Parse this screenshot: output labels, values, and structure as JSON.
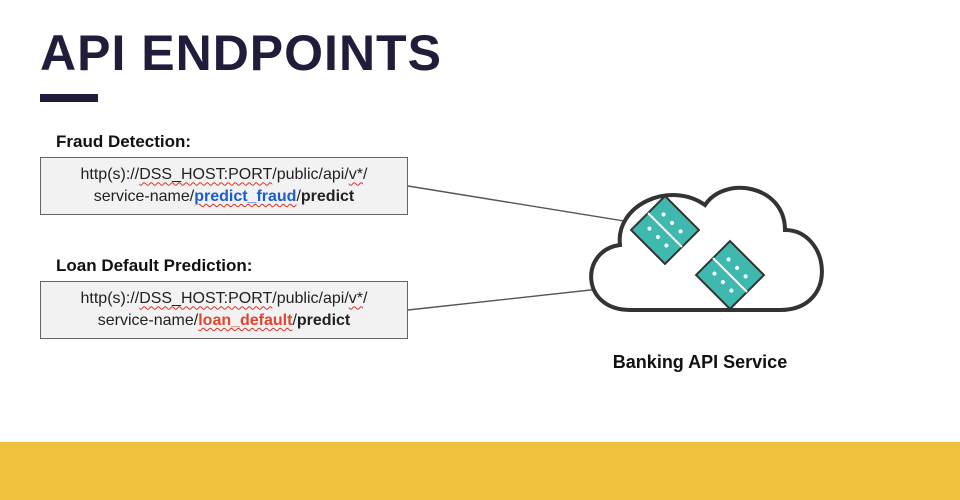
{
  "title": "API ENDPOINTS",
  "endpoints": {
    "fraud": {
      "label": "Fraud Detection:",
      "prefix": "http(s)://",
      "host": "DSS_HOST:PORT",
      "path1": "/public/api/",
      "vseg": "v*",
      "path2_line2a": "service-name",
      "slash": "/",
      "key": "predict_fraud",
      "suffix": "predict"
    },
    "loan": {
      "label": "Loan Default Prediction:",
      "prefix": "http(s)://",
      "host": "DSS_HOST:PORT",
      "path1": "/public/api/",
      "vseg": "v*",
      "path2_line2a": "service-name",
      "slash": "/",
      "key": "loan_default",
      "suffix": "predict"
    }
  },
  "cloud_label": "Banking API Service"
}
